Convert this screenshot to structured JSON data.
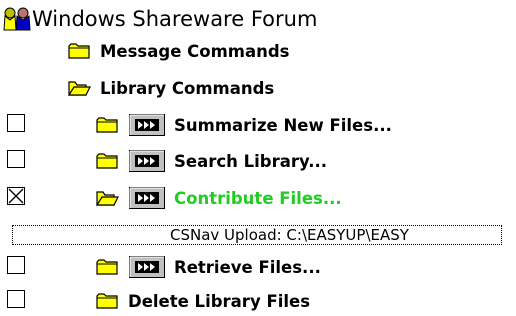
{
  "root": {
    "label": "Windows Shareware Forum",
    "icon": "forum-people-icon"
  },
  "groups": [
    {
      "label": "Message Commands",
      "icon": "folder-closed-icon"
    },
    {
      "label": "Library Commands",
      "icon": "folder-open-icon",
      "expanded": true
    }
  ],
  "commands": [
    {
      "label": "Summarize New Files...",
      "checked": false,
      "folder": "folder-closed-icon",
      "has_run_button": true
    },
    {
      "label": "Search Library...",
      "checked": false,
      "folder": "folder-closed-icon",
      "has_run_button": true
    },
    {
      "label": "Contribute Files...",
      "checked": true,
      "folder": "folder-open-icon",
      "has_run_button": true,
      "color": "#22cc22"
    },
    {
      "label": "Retrieve Files...",
      "checked": false,
      "folder": "folder-closed-icon",
      "has_run_button": true
    },
    {
      "label": "Delete Library Files",
      "checked": false,
      "folder": "folder-closed-icon",
      "has_run_button": false
    }
  ],
  "upload_item": {
    "label": "CSNav Upload: C:\\EASYUP\\EASY"
  },
  "colors": {
    "folder_fill": "#ffff00",
    "run_button_bg": "#c0c0c0",
    "highlight": "#22cc22"
  }
}
